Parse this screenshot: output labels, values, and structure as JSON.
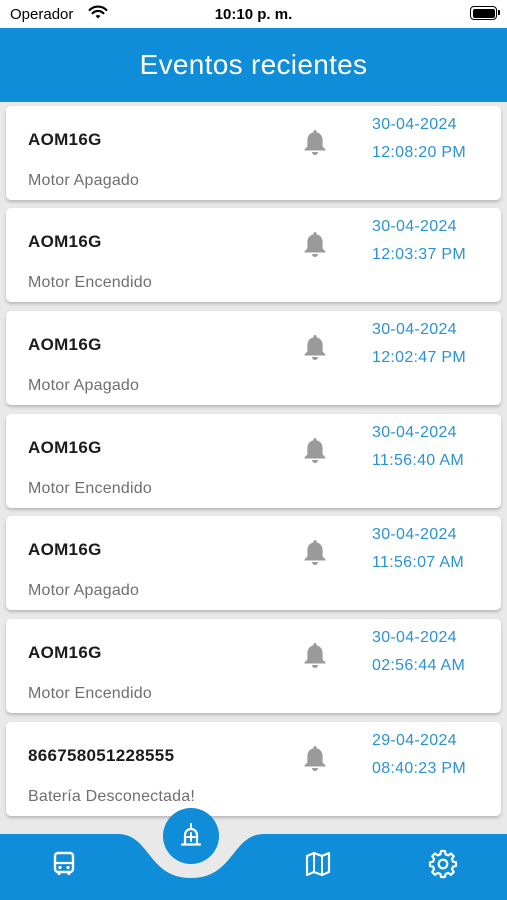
{
  "status_bar": {
    "carrier": "Operador",
    "time": "10:10 p. m."
  },
  "header": {
    "title": "Eventos recientes"
  },
  "events": [
    {
      "plate": "AOM16G",
      "description": "Motor Apagado",
      "date": "30-04-2024",
      "time": "12:08:20 PM"
    },
    {
      "plate": "AOM16G",
      "description": "Motor Encendido",
      "date": "30-04-2024",
      "time": "12:03:37 PM"
    },
    {
      "plate": "AOM16G",
      "description": "Motor Apagado",
      "date": "30-04-2024",
      "time": "12:02:47 PM"
    },
    {
      "plate": "AOM16G",
      "description": "Motor Encendido",
      "date": "30-04-2024",
      "time": "11:56:40 AM"
    },
    {
      "plate": "AOM16G",
      "description": "Motor Apagado",
      "date": "30-04-2024",
      "time": "11:56:07 AM"
    },
    {
      "plate": "AOM16G",
      "description": "Motor Encendido",
      "date": "30-04-2024",
      "time": "02:56:44 AM"
    },
    {
      "plate": "866758051228555",
      "description": "Batería Desconectada!",
      "date": "29-04-2024",
      "time": "08:40:23 PM"
    }
  ],
  "bottom_nav": {
    "items": [
      {
        "icon": "bus-icon"
      },
      {
        "icon": "alert-add-icon",
        "active": true
      },
      {
        "icon": "map-icon"
      },
      {
        "icon": "gear-icon"
      }
    ]
  },
  "colors": {
    "primary": "#0f8dd8",
    "timestamp": "#2b92d6",
    "bell": "#9a9a9a",
    "background": "#e9e9e9"
  }
}
